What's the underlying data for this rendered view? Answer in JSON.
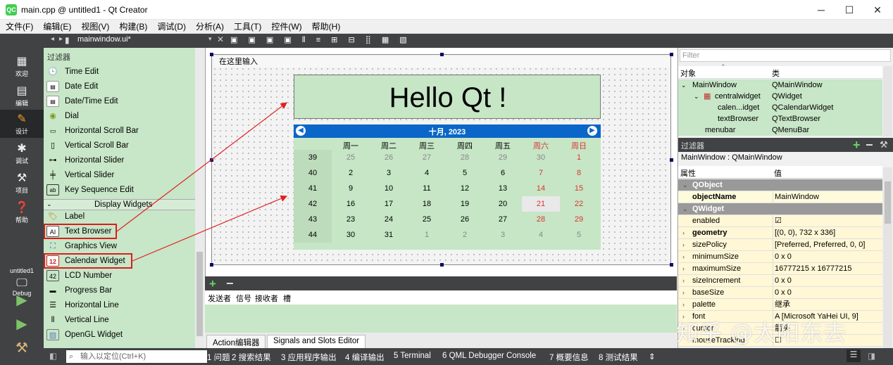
{
  "window": {
    "title": "main.cpp @ untitled1 - Qt Creator",
    "icon_text": "QC",
    "min": "─",
    "max": "☐",
    "close": "✕"
  },
  "menu": [
    "文件(F)",
    "编辑(E)",
    "视图(V)",
    "构建(B)",
    "调试(D)",
    "分析(A)",
    "工具(T)",
    "控件(W)",
    "帮助(H)"
  ],
  "modes": [
    {
      "label": "欢迎",
      "icon": "grid-icon"
    },
    {
      "label": "编辑",
      "icon": "edit-icon"
    },
    {
      "label": "设计",
      "icon": "pencil-icon"
    },
    {
      "label": "调试",
      "icon": "bug-icon"
    },
    {
      "label": "项目",
      "icon": "wrench-icon"
    },
    {
      "label": "帮助",
      "icon": "help-icon"
    }
  ],
  "kit": {
    "project": "untitled1",
    "config": "Debug"
  },
  "editor_tab": "mainwindow.ui*",
  "widget_box": {
    "filter_label": "过滤器",
    "items_top": [
      "Time Edit",
      "Date Edit",
      "Date/Time Edit",
      "Dial",
      "Horizontal Scroll Bar",
      "Vertical Scroll Bar",
      "Horizontal Slider",
      "Vertical Slider",
      "Key Sequence Edit"
    ],
    "category": "Display Widgets",
    "items_bottom": [
      "Label",
      "Text Browser",
      "Graphics View",
      "Calendar Widget",
      "LCD Number",
      "Progress Bar",
      "Horizontal Line",
      "Vertical Line",
      "OpenGL Widget"
    ]
  },
  "form": {
    "menu_placeholder": "在这里输入",
    "hello_text": "Hello Qt !",
    "calendar": {
      "month_label": "十月, 2023",
      "headers": [
        "周一",
        "周二",
        "周三",
        "周四",
        "周五",
        "周六",
        "周日"
      ],
      "weeks": [
        "39",
        "40",
        "41",
        "42",
        "43",
        "44"
      ],
      "days": [
        [
          "25",
          "26",
          "27",
          "28",
          "29",
          "30",
          "1"
        ],
        [
          "2",
          "3",
          "4",
          "5",
          "6",
          "7",
          "8"
        ],
        [
          "9",
          "10",
          "11",
          "12",
          "13",
          "14",
          "15"
        ],
        [
          "16",
          "17",
          "18",
          "19",
          "20",
          "21",
          "22"
        ],
        [
          "23",
          "24",
          "25",
          "26",
          "27",
          "28",
          "29"
        ],
        [
          "30",
          "31",
          "1",
          "2",
          "3",
          "4",
          "5"
        ]
      ],
      "today": "21"
    }
  },
  "signals": {
    "plus": "+",
    "minus": "−",
    "headers": [
      "发送者",
      "信号",
      "接收者",
      "槽"
    ]
  },
  "bottom_tabs": [
    "Action编辑器",
    "Signals and Slots Editor"
  ],
  "object_inspector": {
    "filter_placeholder": "Filter",
    "headers": [
      "对象",
      "类"
    ],
    "rows": [
      {
        "name": "MainWindow",
        "cls": "QMainWindow"
      },
      {
        "name": "centralwidget",
        "cls": "QWidget"
      },
      {
        "name": "calen...idget",
        "cls": "QCalendarWidget"
      },
      {
        "name": "textBrowser",
        "cls": "QTextBrowser"
      },
      {
        "name": "menubar",
        "cls": "QMenuBar"
      }
    ]
  },
  "property_editor": {
    "filter_label": "过滤器",
    "context": "MainWindow : QMainWindow",
    "headers": [
      "属性",
      "值"
    ],
    "rows": [
      {
        "name": "QObject",
        "value": "",
        "type": "group"
      },
      {
        "name": "objectName",
        "value": "MainWindow",
        "type": "yellow",
        "bold": true
      },
      {
        "name": "QWidget",
        "value": "",
        "type": "group"
      },
      {
        "name": "enabled",
        "value": "☑",
        "type": "cream"
      },
      {
        "name": "geometry",
        "value": "[(0, 0), 732 x 336]",
        "type": "cream",
        "bold": true
      },
      {
        "name": "sizePolicy",
        "value": "[Preferred, Preferred, 0, 0]",
        "type": "cream"
      },
      {
        "name": "minimumSize",
        "value": "0 x 0",
        "type": "cream"
      },
      {
        "name": "maximumSize",
        "value": "16777215 x 16777215",
        "type": "cream"
      },
      {
        "name": "sizeIncrement",
        "value": "0 x 0",
        "type": "cream"
      },
      {
        "name": "baseSize",
        "value": "0 x 0",
        "type": "cream"
      },
      {
        "name": "palette",
        "value": "继承",
        "type": "cream"
      },
      {
        "name": "font",
        "value": "A [Microsoft YaHei UI, 9]",
        "type": "cream"
      },
      {
        "name": "cursor",
        "value": "箭头",
        "type": "cream"
      },
      {
        "name": "mouseTracking",
        "value": "☐",
        "type": "cream"
      }
    ]
  },
  "status_bar": {
    "locate_placeholder": "输入以定位(Ctrl+K)",
    "items": [
      "1 问题",
      "2 搜索结果",
      "3 应用程序输出",
      "4 编译输出",
      "5 Terminal",
      "6 QML Debugger Console",
      "7 概要信息",
      "8 测试结果"
    ]
  },
  "watermark": "知乎 @太阳东去"
}
